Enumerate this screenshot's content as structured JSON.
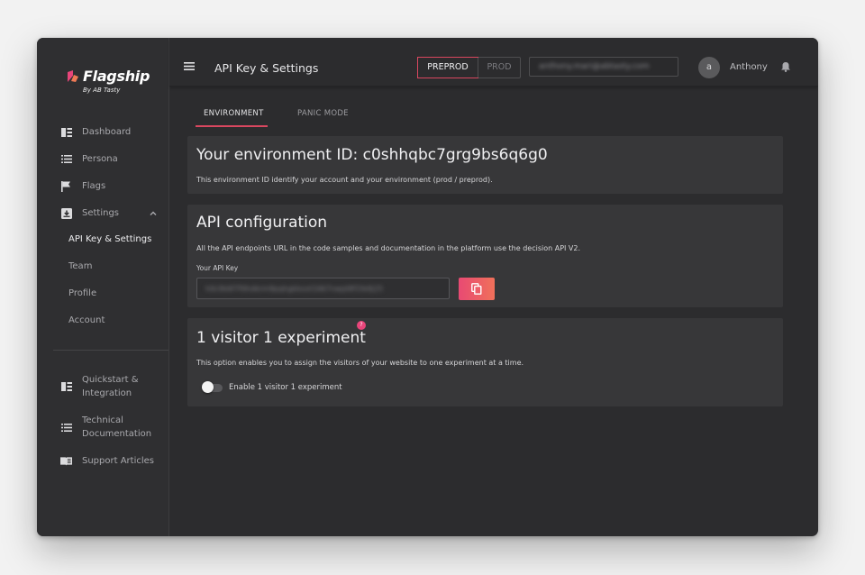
{
  "app": {
    "logo_text": "Flagship",
    "logo_sub": "By AB Tasty"
  },
  "sidebar": {
    "items": [
      {
        "label": "Dashboard",
        "icon": "dashboard-icon"
      },
      {
        "label": "Persona",
        "icon": "list-icon"
      },
      {
        "label": "Flags",
        "icon": "flag-icon"
      },
      {
        "label": "Settings",
        "icon": "settings-download-icon",
        "expanded": true
      }
    ],
    "sub_items": [
      {
        "label": "API Key & Settings",
        "active": true
      },
      {
        "label": "Team"
      },
      {
        "label": "Profile"
      },
      {
        "label": "Account"
      }
    ],
    "bottom_items": [
      {
        "line1": "Quickstart &",
        "line2": "Integration",
        "icon": "quickstart-icon"
      },
      {
        "line1": "Technical",
        "line2": "Documentation",
        "icon": "docs-list-icon"
      },
      {
        "line1": "Support Articles",
        "line2": "",
        "icon": "book-icon"
      }
    ]
  },
  "header": {
    "title": "API Key & Settings",
    "env_preprod": "PREPROD",
    "env_prod": "PROD",
    "env_selected": "PREPROD",
    "account_email": "anthony.mari@abtasty.com",
    "avatar_letter": "a",
    "username": "Anthony"
  },
  "tabs": [
    {
      "label": "ENVIRONMENT",
      "active": true
    },
    {
      "label": "PANIC MODE",
      "active": false
    }
  ],
  "environment_card": {
    "title": "Your environment ID: c0shhqbc7grg9bs6q6g0",
    "description": "This environment ID identify your account and your environment (prod / preprod)."
  },
  "api_card": {
    "title": "API configuration",
    "description": "All the API endpoints URL in the code samples and documentation in the platform use the decision API V2.",
    "key_label": "Your API Key",
    "key_value": "h0c9k6f7f0hdkrm9pqhgkbxxt1667nwpt8f1fe9j25"
  },
  "visitor_card": {
    "title": "1 visitor 1 experiment",
    "help": "?",
    "description": "This option enables you to assign the visitors of your website to one experiment at a time.",
    "toggle_label": "Enable 1 visitor 1 experiment",
    "toggle_on": false
  },
  "colors": {
    "accent": "#d9475f",
    "copy_gradient_start": "#e84a73",
    "copy_gradient_end": "#f0705a"
  }
}
